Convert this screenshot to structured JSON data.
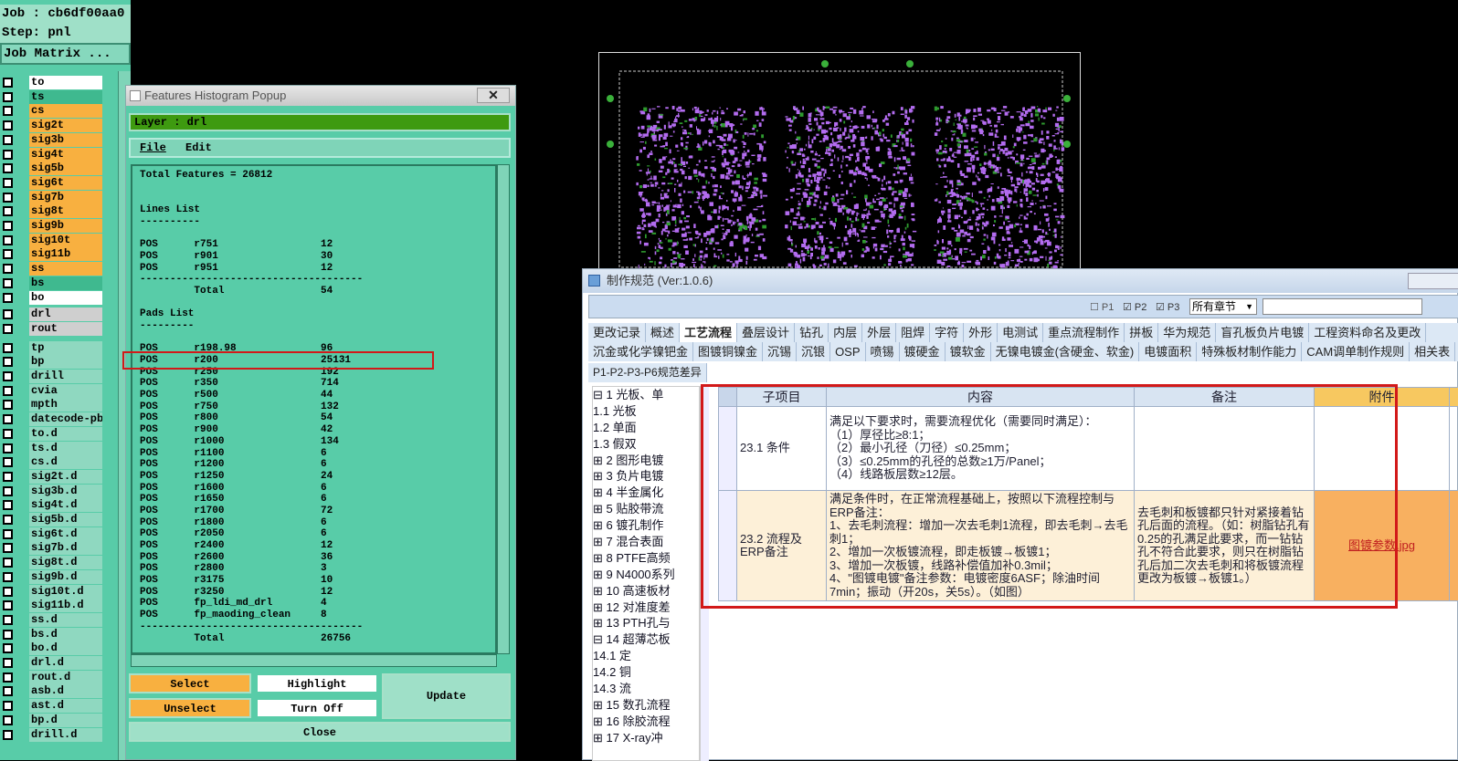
{
  "job_panel": {
    "job_label": "Job : cb6df00aa0",
    "step_label": "Step: pnl",
    "matrix_button": "Job Matrix ...",
    "layers": [
      {
        "name": "to",
        "color": "white"
      },
      {
        "name": "ts",
        "color": "teal"
      },
      {
        "name": "cs",
        "color": "orange"
      },
      {
        "name": "sig2t",
        "color": "orange"
      },
      {
        "name": "sig3b",
        "color": "orange"
      },
      {
        "name": "sig4t",
        "color": "orange"
      },
      {
        "name": "sig5b",
        "color": "orange"
      },
      {
        "name": "sig6t",
        "color": "orange"
      },
      {
        "name": "sig7b",
        "color": "orange"
      },
      {
        "name": "sig8t",
        "color": "orange"
      },
      {
        "name": "sig9b",
        "color": "orange"
      },
      {
        "name": "sig10t",
        "color": "orange"
      },
      {
        "name": "sig11b",
        "color": "orange"
      },
      {
        "name": "ss",
        "color": "orange"
      },
      {
        "name": "bs",
        "color": "teal"
      },
      {
        "name": "bo",
        "color": "white"
      },
      {
        "name": "drl",
        "color": "gray"
      },
      {
        "name": "rout",
        "color": "gray"
      },
      {
        "name": "tp",
        "color": "ltteal"
      },
      {
        "name": "bp",
        "color": "ltteal"
      },
      {
        "name": "drill",
        "color": "ltteal"
      },
      {
        "name": "cvia",
        "color": "ltteal"
      },
      {
        "name": "mpth",
        "color": "ltteal"
      },
      {
        "name": "datecode-pbc",
        "color": "ltteal"
      },
      {
        "name": "to.d",
        "color": "ltteal"
      },
      {
        "name": "ts.d",
        "color": "ltteal"
      },
      {
        "name": "cs.d",
        "color": "ltteal"
      },
      {
        "name": "sig2t.d",
        "color": "ltteal"
      },
      {
        "name": "sig3b.d",
        "color": "ltteal"
      },
      {
        "name": "sig4t.d",
        "color": "ltteal"
      },
      {
        "name": "sig5b.d",
        "color": "ltteal"
      },
      {
        "name": "sig6t.d",
        "color": "ltteal"
      },
      {
        "name": "sig7b.d",
        "color": "ltteal"
      },
      {
        "name": "sig8t.d",
        "color": "ltteal"
      },
      {
        "name": "sig9b.d",
        "color": "ltteal"
      },
      {
        "name": "sig10t.d",
        "color": "ltteal"
      },
      {
        "name": "sig11b.d",
        "color": "ltteal"
      },
      {
        "name": "ss.d",
        "color": "ltteal"
      },
      {
        "name": "bs.d",
        "color": "ltteal"
      },
      {
        "name": "bo.d",
        "color": "ltteal"
      },
      {
        "name": "drl.d",
        "color": "ltteal"
      },
      {
        "name": "rout.d",
        "color": "ltteal"
      },
      {
        "name": "asb.d",
        "color": "ltteal"
      },
      {
        "name": "ast.d",
        "color": "ltteal"
      },
      {
        "name": "bp.d",
        "color": "ltteal"
      },
      {
        "name": "drill.d",
        "color": "ltteal"
      }
    ]
  },
  "histogram": {
    "title": "Features Histogram Popup",
    "close": "✕",
    "layer_label": "Layer :  drl",
    "menu_file": "File",
    "menu_edit": "Edit",
    "lines": [
      "Total Features = 26812",
      "",
      "",
      "Lines List",
      "----------",
      "",
      "POS      r751                 12",
      "POS      r901                 30",
      "POS      r951                 12",
      "-------------------------------------",
      "         Total                54",
      "",
      "Pads List",
      "---------",
      "",
      "POS      r198.98              96",
      "POS      r200                 25131",
      "POS      r250                 192",
      "POS      r350                 714",
      "POS      r500                 44",
      "POS      r750                 132",
      "POS      r800                 54",
      "POS      r900                 42",
      "POS      r1000                134",
      "POS      r1100                6",
      "POS      r1200                6",
      "POS      r1250                24",
      "POS      r1600                6",
      "POS      r1650                6",
      "POS      r1700                72",
      "POS      r1800                6",
      "POS      r2050                6",
      "POS      r2400                12",
      "POS      r2600                36",
      "POS      r2800                3",
      "POS      r3175                10",
      "POS      r3250                12",
      "POS      fp_ldi_md_drl        4",
      "POS      fp_maoding_clean     8",
      "-------------------------------------",
      "         Total                26756"
    ],
    "btn_select": "Select",
    "btn_highlight": "Highlight",
    "btn_update": "Update",
    "btn_unselect": "Unselect",
    "btn_turnoff": "Turn Off",
    "btn_close": "Close"
  },
  "spec": {
    "title": "制作规范 (Ver:1.0.6)",
    "toolbar": {
      "p1": "P1",
      "p2": "P2",
      "p3": "P3",
      "chapter_select": "所有章节"
    },
    "tabs_row1": [
      "更改记录",
      "概述",
      "工艺流程",
      "叠层设计",
      "钻孔",
      "内层",
      "外层",
      "阻焊",
      "字符",
      "外形",
      "电测试",
      "重点流程制作",
      "拼板",
      "华为规范",
      "盲孔板负片电镀",
      "工程资料命名及更改"
    ],
    "active_tab": "工艺流程",
    "tabs_row2": [
      "沉金或化学镍钯金",
      "图镀铜镍金",
      "沉锡",
      "沉银",
      "OSP",
      "喷锡",
      "镀硬金",
      "镀软金",
      "无镍电镀金(含硬金、软金)",
      "电镀面积",
      "特殊板材制作能力",
      "CAM调单制作规则",
      "相关表"
    ],
    "tabs_row3": [
      "P1-P2-P3-P6规范差异"
    ],
    "tree": [
      "⊟ 1 光板、单",
      "   1.1 光板",
      "   1.2 单面",
      "   1.3 假双",
      "⊞ 2 图形电镀",
      "⊞ 3 负片电镀",
      "⊞ 4 半金属化",
      "⊞ 5 贴胶带流",
      "⊞ 6 镀孔制作",
      "⊞ 7 混合表面",
      "⊞ 8 PTFE高频",
      "⊞ 9 N4000系列",
      "⊞ 10 高速板材",
      "⊞ 12 对准度差",
      "⊞ 13 PTH孔与",
      "⊟ 14 超薄芯板",
      "   14.1 定",
      "   14.2 铜",
      "   14.3 流",
      "⊞ 15 数孔流程",
      "⊞ 16 除胶流程",
      "⊞ 17 X-ray冲"
    ],
    "table": {
      "headers": [
        "子项目",
        "内容",
        "备注",
        "附件"
      ],
      "rows": [
        {
          "item": "23.1 条件",
          "content": [
            "满足以下要求时，需要流程优化（需要同时满足）：",
            "（1）厚径比≥8:1；",
            "（2）最小孔径（刀径）≤0.25mm；",
            "（3）≤0.25mm的孔径的总数≥1万/Panel；",
            "（4）线路板层数≥12层。"
          ],
          "note": "",
          "attach": ""
        },
        {
          "item": "23.2 流程及ERP备注",
          "content": [
            "满足条件时，在正常流程基础上，按照以下流程控制与ERP备注：",
            "1、去毛刺流程：增加一次去毛刺1流程，即去毛刺→去毛刺1；",
            "2、增加一次板镀流程，即走板镀→板镀1；",
            "3、增加一次板镀，线路补偿值加补0.3mil；",
            "4、\"图镀电镀\"备注参数：电镀密度6ASF；除油时间7min；振动（开20s，关5s）。（如图）"
          ],
          "note": "去毛刺和板镀都只针对紧接着钻孔后面的流程。（如：树脂钻孔有0.25的孔满足此要求，而一钻钻孔不符合此要求，则只在树脂钻孔后加二次去毛刺和将板镀流程更改为板镀→板镀1。）",
          "attach": "图镀参数.jpg"
        }
      ]
    }
  },
  "colors": {
    "panel_teal": "#58cca8",
    "layer_green": "#3e9a10",
    "orange_btn": "#f8b040",
    "highlight_red": "#d21919",
    "pcb_purple": "#b36cf0"
  }
}
